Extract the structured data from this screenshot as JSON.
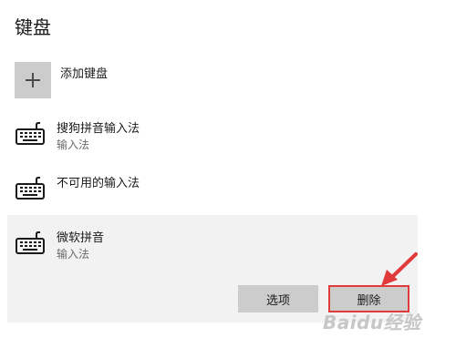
{
  "page": {
    "title": "键盘"
  },
  "add_keyboard": {
    "label": "添加键盘"
  },
  "keyboards": [
    {
      "name": "搜狗拼音输入法",
      "type": "输入法"
    },
    {
      "name": "不可用的输入法",
      "type": ""
    },
    {
      "name": "微软拼音",
      "type": "输入法"
    }
  ],
  "actions": {
    "options_label": "选项",
    "remove_label": "删除"
  },
  "watermark": "Baidu经验",
  "icons": {
    "add": "plus-icon",
    "keyboard": "keyboard-icon",
    "annotation": "red-arrow-icon"
  },
  "colors": {
    "highlight_border": "#e03a3a",
    "button_bg": "#cccccc",
    "selected_bg": "#f2f2f2"
  }
}
